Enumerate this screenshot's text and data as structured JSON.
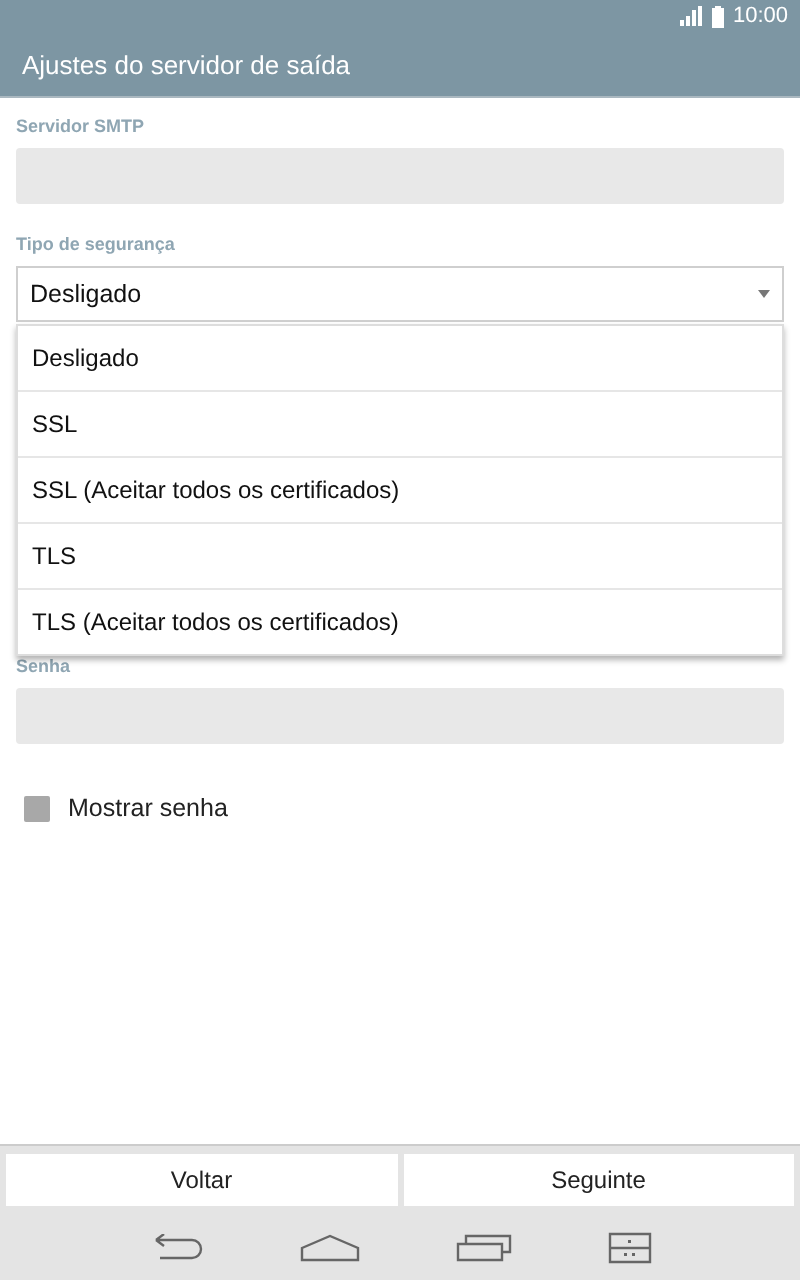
{
  "status_bar": {
    "time": "10:00"
  },
  "title": "Ajustes do servidor de saída",
  "smtp": {
    "label": "Servidor SMTP"
  },
  "security": {
    "label": "Tipo de segurança",
    "value": "Desligado",
    "options": [
      "Desligado",
      "SSL",
      "SSL (Aceitar todos os certificados)",
      "TLS",
      "TLS (Aceitar todos os certificados)"
    ]
  },
  "password": {
    "label": "Senha"
  },
  "show_password": {
    "label": "Mostrar senha",
    "checked": false
  },
  "buttons": [
    "Voltar",
    "Seguinte"
  ]
}
